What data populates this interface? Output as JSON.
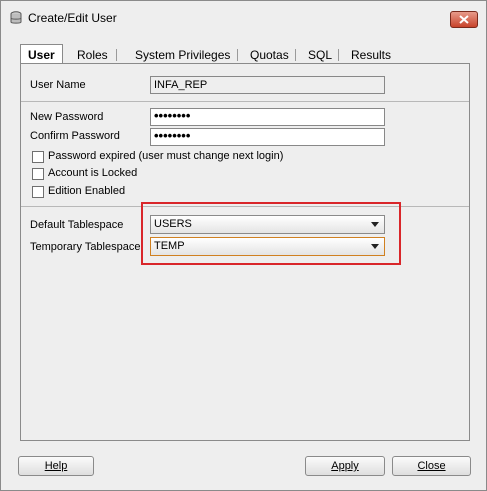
{
  "window": {
    "title": "Create/Edit User",
    "close_icon": "close-icon"
  },
  "tabs": [
    {
      "label": "User",
      "active": true
    },
    {
      "label": "Roles",
      "active": false
    },
    {
      "label": "System Privileges",
      "active": false
    },
    {
      "label": "Quotas",
      "active": false
    },
    {
      "label": "SQL",
      "active": false
    },
    {
      "label": "Results",
      "active": false
    }
  ],
  "form": {
    "user_name": {
      "label": "User Name",
      "value": "INFA_REP"
    },
    "new_password": {
      "label": "New Password",
      "value": "••••••••"
    },
    "confirm_password": {
      "label": "Confirm Password",
      "value": "••••••••"
    },
    "checkboxes": [
      {
        "label": "Password expired (user must change next login)",
        "checked": false
      },
      {
        "label": "Account is Locked",
        "checked": false
      },
      {
        "label": "Edition Enabled",
        "checked": false
      }
    ],
    "default_tablespace": {
      "label": "Default Tablespace",
      "value": "USERS"
    },
    "temporary_tablespace": {
      "label": "Temporary Tablespace",
      "value": "TEMP"
    }
  },
  "buttons": {
    "help": "Help",
    "apply": "Apply",
    "close": "Close"
  },
  "colors": {
    "highlight": "#d9262a",
    "focus": "#d08020"
  }
}
